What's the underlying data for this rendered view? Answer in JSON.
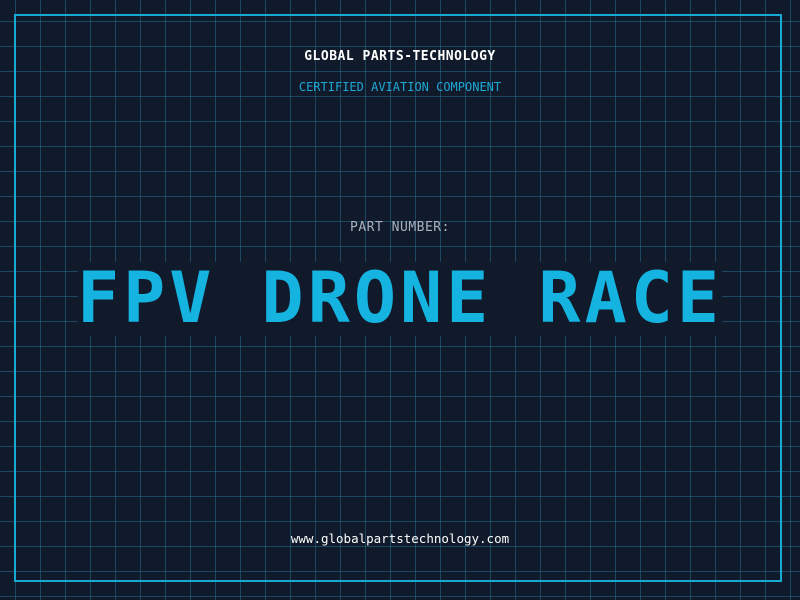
{
  "header": {
    "brand": "GLOBAL PARTS-TECHNOLOGY",
    "tagline": "CERTIFIED AVIATION COMPONENT"
  },
  "main": {
    "part_label": "PART NUMBER:",
    "part_number": "FPV DRONE RACE"
  },
  "footer": {
    "website": "www.globalpartstechnology.com"
  },
  "colors": {
    "background": "#101a2b",
    "grid": "#246e8c",
    "accent": "#14b3e0",
    "text": "#ffffff",
    "muted": "#aab2c0"
  }
}
